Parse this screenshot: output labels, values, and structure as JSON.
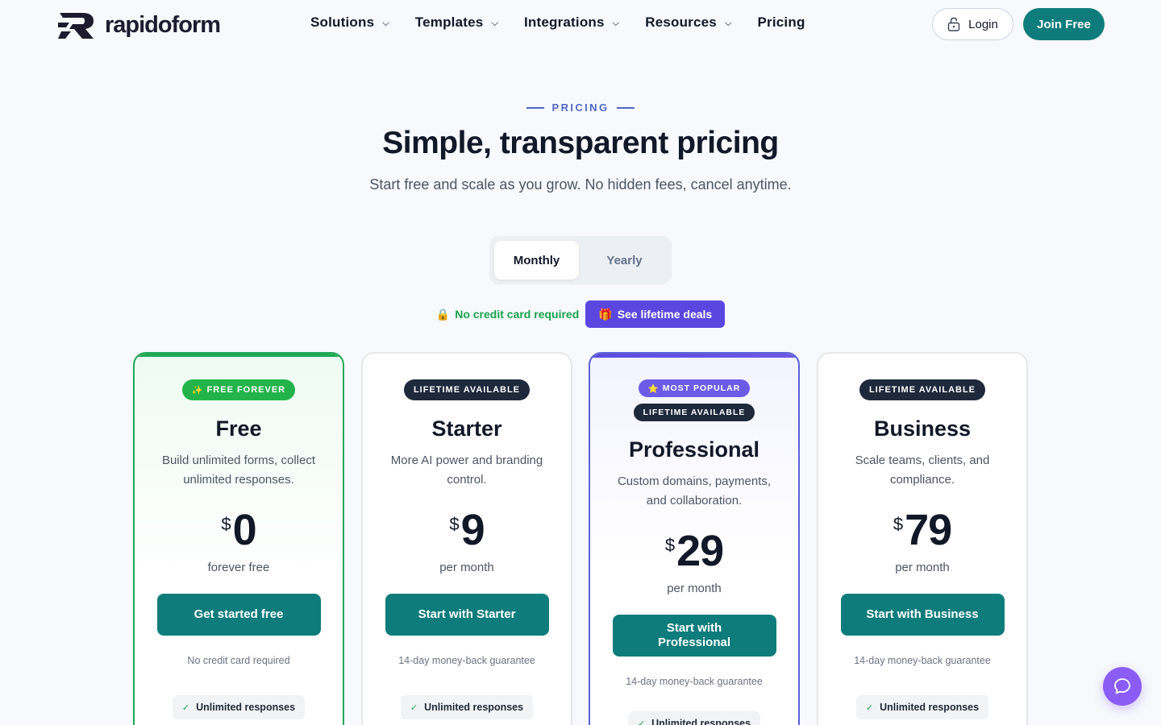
{
  "brand": {
    "name": "rapidoform"
  },
  "nav": {
    "items": [
      {
        "label": "Solutions",
        "has_menu": true
      },
      {
        "label": "Templates",
        "has_menu": true
      },
      {
        "label": "Integrations",
        "has_menu": true
      },
      {
        "label": "Resources",
        "has_menu": true
      },
      {
        "label": "Pricing",
        "has_menu": false
      }
    ],
    "chevron": "⌵",
    "login_label": "Login",
    "join_label": "Join Free"
  },
  "hero": {
    "eyebrow": "PRICING",
    "title": "Simple, transparent pricing",
    "subtitle": "Start free and scale as you grow. No hidden fees, cancel anytime."
  },
  "billing_toggle": {
    "options": [
      "Monthly",
      "Yearly"
    ],
    "selected": "Monthly"
  },
  "notes": {
    "no_card_icon": "🔒",
    "no_card": "No credit card required",
    "lifetime_icon": "🎁",
    "lifetime_label": "See lifetime deals"
  },
  "plans": [
    {
      "badge_icon": "✨",
      "badge": "FREE FOREVER",
      "name": "Free",
      "description": "Build unlimited forms, collect unlimited responses.",
      "currency": "$",
      "price": "0",
      "period": "forever free",
      "cta": "Get started free",
      "fine_print": "No credit card required",
      "feature": "Unlimited responses"
    },
    {
      "badge": "LIFETIME AVAILABLE",
      "name": "Starter",
      "description": "More AI power and branding control.",
      "currency": "$",
      "price": "9",
      "period": "per month",
      "cta": "Start with Starter",
      "fine_print": "14-day money-back guarantee",
      "feature": "Unlimited responses"
    },
    {
      "popular_icon": "⭐",
      "popular": "MOST POPULAR",
      "badge": "LIFETIME AVAILABLE",
      "name": "Professional",
      "description": "Custom domains, payments, and collaboration.",
      "currency": "$",
      "price": "29",
      "period": "per month",
      "cta": "Start with Professional",
      "fine_print": "14-day money-back guarantee",
      "feature": "Unlimited responses"
    },
    {
      "badge": "LIFETIME AVAILABLE",
      "name": "Business",
      "description": "Scale teams, clients, and compliance.",
      "currency": "$",
      "price": "79",
      "period": "per month",
      "cta": "Start with Business",
      "fine_print": "14-day money-back guarantee",
      "feature": "Unlimited responses"
    }
  ],
  "feature_check": "✓",
  "colors": {
    "brand_teal": "#0e7c7b",
    "accent_purple": "#5b47e0",
    "success_green": "#22a855",
    "eyebrow_blue": "#5067c4"
  },
  "icons": {
    "logo": "rapidoform-logo-icon",
    "login": "lock-icon",
    "chat": "chat-bubble-icon"
  }
}
